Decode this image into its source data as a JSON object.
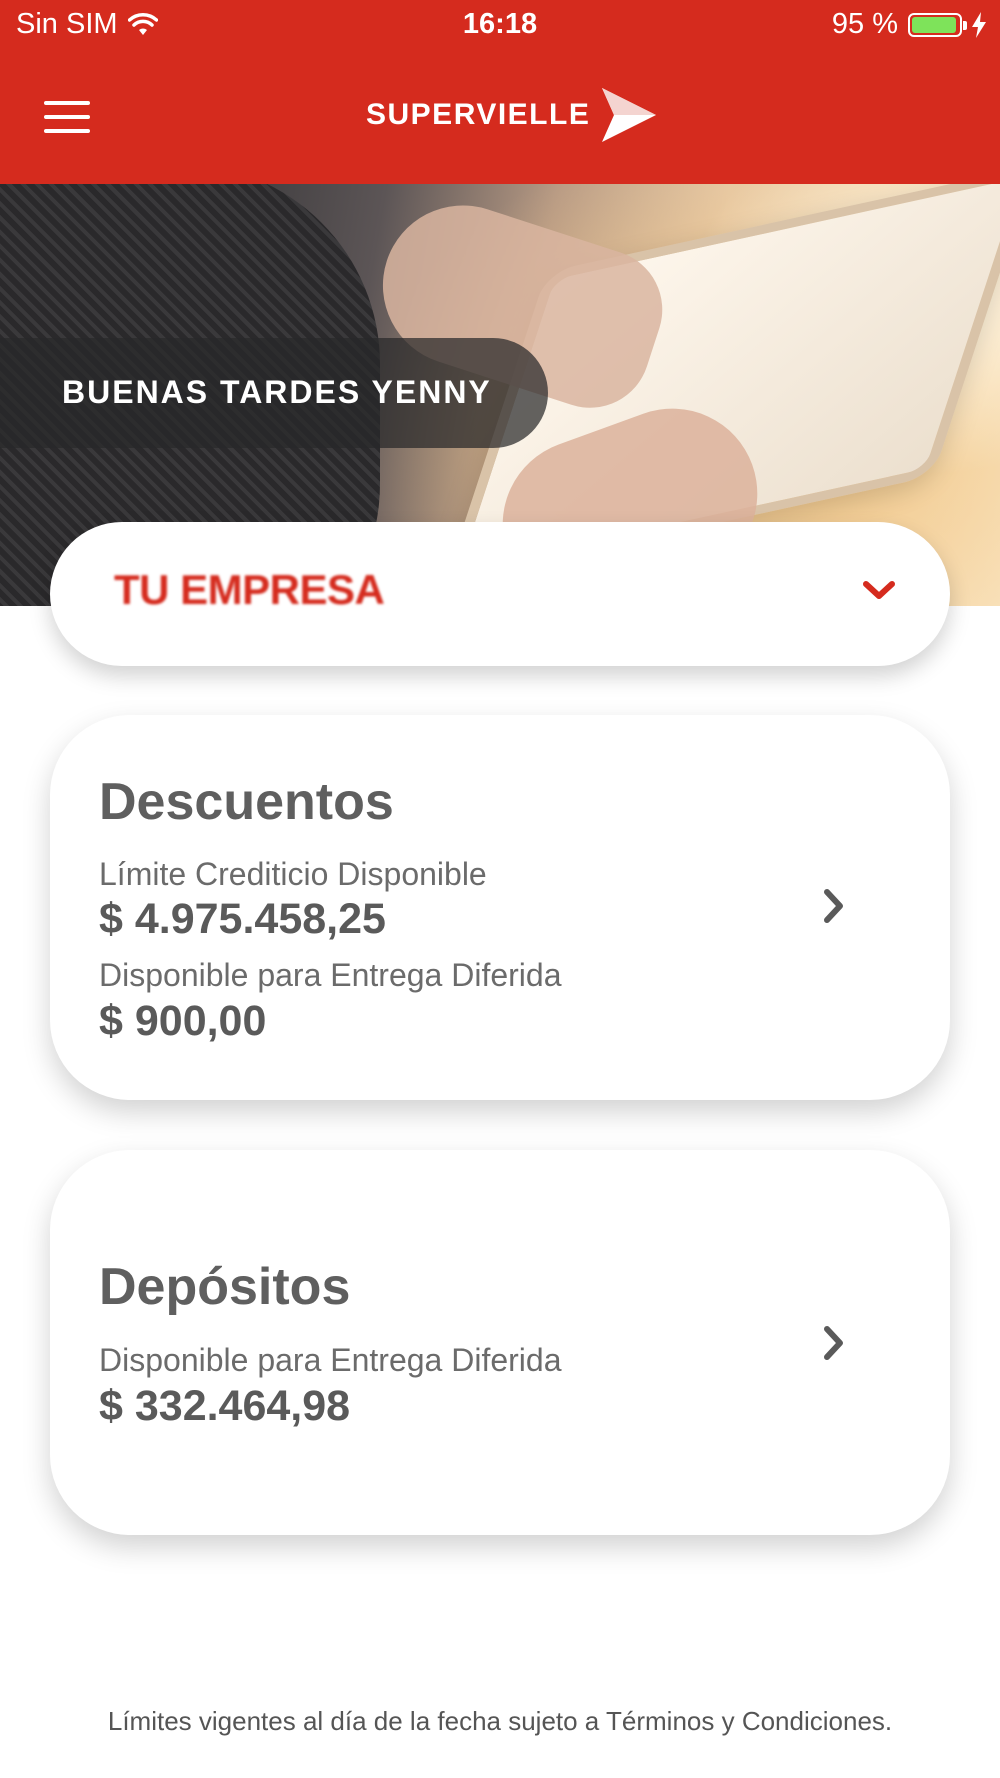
{
  "status_bar": {
    "carrier": "Sin SIM",
    "time": "16:18",
    "battery": "95 %",
    "battery_level": 0.95,
    "wifi_icon": "wifi-icon",
    "charging_icon": "bolt-icon"
  },
  "navbar": {
    "menu_icon": "hamburger-menu-icon",
    "brand": "SUPERVIELLE",
    "brand_color": "#d52b1e"
  },
  "hero": {
    "greeting": "BUENAS TARDES YENNY"
  },
  "company_selector": {
    "value": "TU EMPRESA",
    "icon": "chevron-down-icon"
  },
  "cards": {
    "descuentos": {
      "title": "Descuentos",
      "limit_label": "Límite Crediticio Disponible",
      "limit_value": "$ 4.975.458,25",
      "deferred_label": "Disponible para Entrega Diferida",
      "deferred_value": "$ 900,00"
    },
    "depositos": {
      "title": "Depósitos",
      "deferred_label": "Disponible para Entrega Diferida",
      "deferred_value": "$ 332.464,98"
    }
  },
  "footer": {
    "note": "Límites vigentes al día de la fecha sujeto a Términos y Condiciones."
  }
}
